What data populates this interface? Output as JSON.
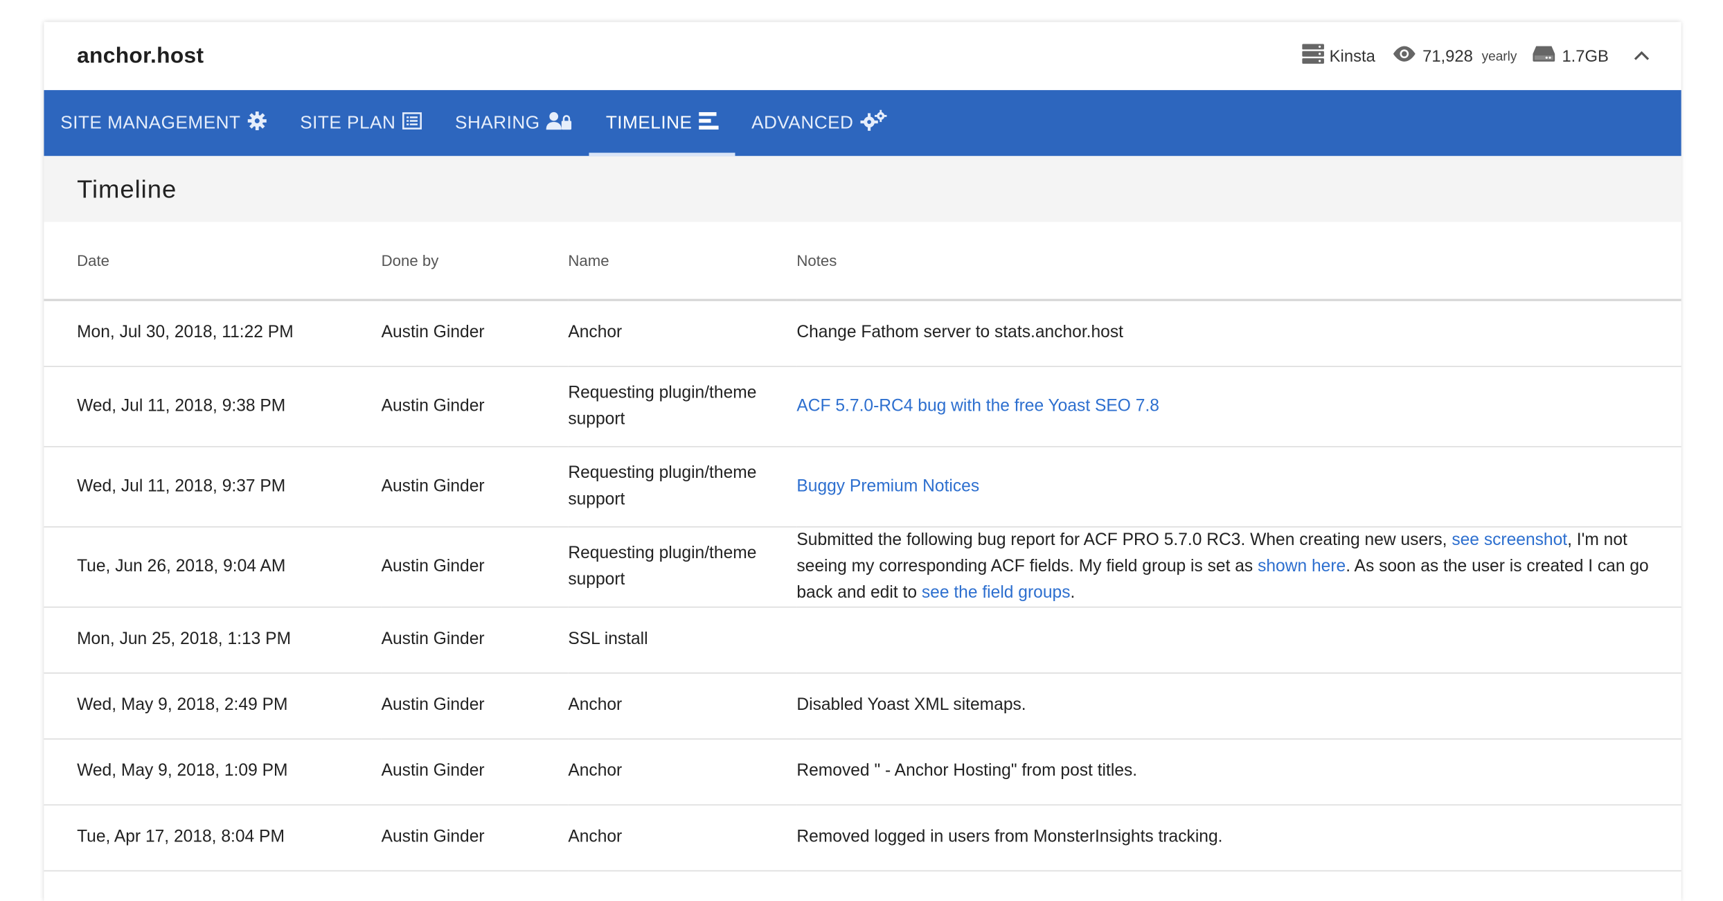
{
  "site": {
    "title": "anchor.host",
    "host_label": "Kinsta",
    "visits_value": "71,928",
    "visits_period": "yearly",
    "storage": "1.7GB"
  },
  "nav": {
    "tabs": [
      {
        "label": "SITE MANAGEMENT",
        "icon": "gear-icon"
      },
      {
        "label": "SITE PLAN",
        "icon": "list-icon"
      },
      {
        "label": "SHARING",
        "icon": "user-lock-icon"
      },
      {
        "label": "TIMELINE",
        "icon": "timeline-icon"
      },
      {
        "label": "ADVANCED",
        "icon": "gears-icon"
      }
    ],
    "active": "TIMELINE"
  },
  "section": {
    "title": "Timeline"
  },
  "colors": {
    "nav_bg": "#2d66be",
    "link": "#2d6fcf"
  },
  "table": {
    "headers": {
      "date": "Date",
      "done_by": "Done by",
      "name": "Name",
      "notes": "Notes"
    },
    "rows": [
      {
        "date": "Mon, Jul 30, 2018, 11:22 PM",
        "done_by": "Austin Ginder",
        "name": "Anchor",
        "notes": [
          {
            "text": "Change Fathom server to stats.anchor.host"
          }
        ]
      },
      {
        "date": "Wed, Jul 11, 2018, 9:38 PM",
        "done_by": "Austin Ginder",
        "name": "Requesting plugin/theme support",
        "notes": [
          {
            "text": "ACF 5.7.0-RC4 bug with the free Yoast SEO 7.8",
            "link": true
          }
        ]
      },
      {
        "date": "Wed, Jul 11, 2018, 9:37 PM",
        "done_by": "Austin Ginder",
        "name": "Requesting plugin/theme support",
        "notes": [
          {
            "text": "Buggy Premium Notices",
            "link": true
          }
        ]
      },
      {
        "date": "Tue, Jun 26, 2018, 9:04 AM",
        "done_by": "Austin Ginder",
        "name": "Requesting plugin/theme support",
        "notes": [
          {
            "text": "Submitted the following bug report for ACF PRO 5.7.0 RC3. When creating new users, "
          },
          {
            "text": "see screenshot",
            "link": true
          },
          {
            "text": ", I'm not seeing my corresponding ACF fields. My field group is set as "
          },
          {
            "text": "shown here",
            "link": true
          },
          {
            "text": ". As soon as the user is created I can go back and edit to "
          },
          {
            "text": "see the field groups",
            "link": true
          },
          {
            "text": "."
          }
        ]
      },
      {
        "date": "Mon, Jun 25, 2018, 1:13 PM",
        "done_by": "Austin Ginder",
        "name": "SSL install",
        "notes": []
      },
      {
        "date": "Wed, May 9, 2018, 2:49 PM",
        "done_by": "Austin Ginder",
        "name": "Anchor",
        "notes": [
          {
            "text": "Disabled Yoast XML sitemaps."
          }
        ]
      },
      {
        "date": "Wed, May 9, 2018, 1:09 PM",
        "done_by": "Austin Ginder",
        "name": "Anchor",
        "notes": [
          {
            "text": "Removed \" - Anchor Hosting\" from post titles."
          }
        ]
      },
      {
        "date": "Tue, Apr 17, 2018, 8:04 PM",
        "done_by": "Austin Ginder",
        "name": "Anchor",
        "notes": [
          {
            "text": "Removed logged in users from MonsterInsights tracking."
          }
        ]
      }
    ]
  }
}
